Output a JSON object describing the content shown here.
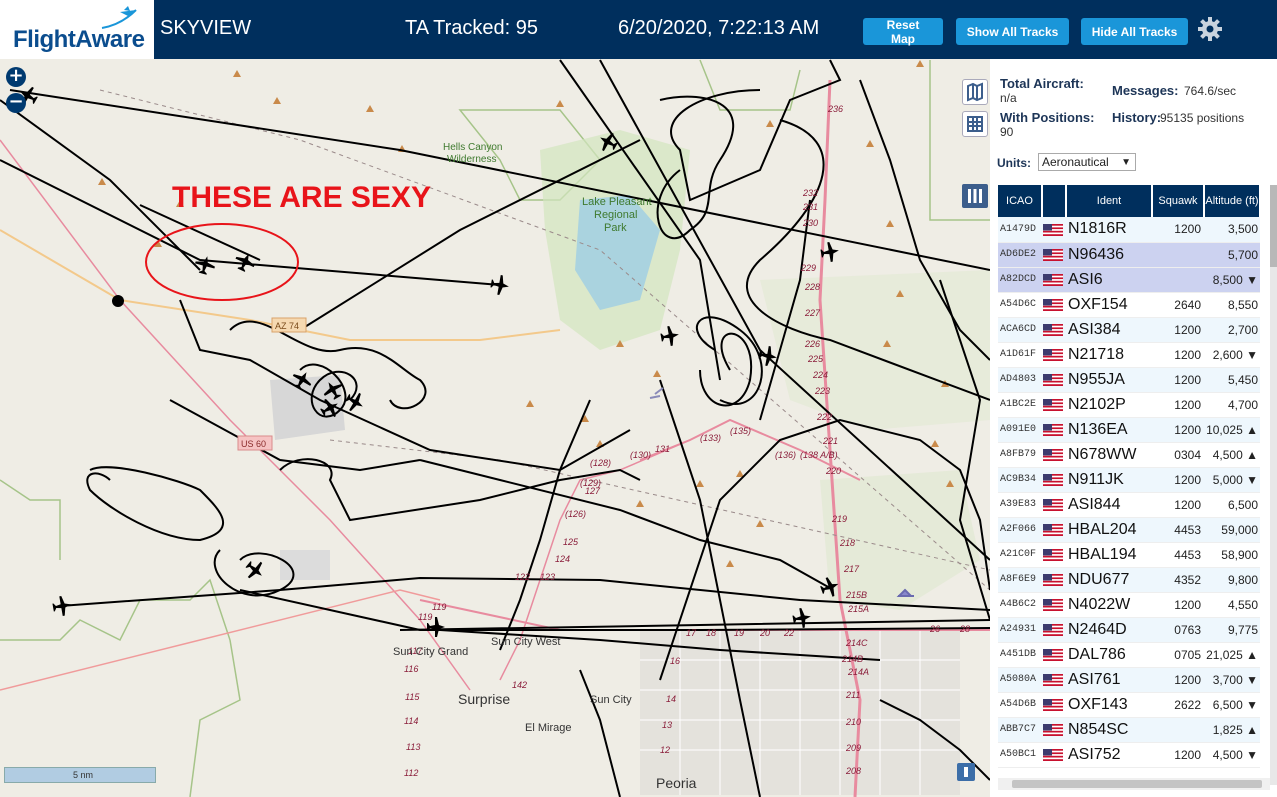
{
  "brand": {
    "logo_text": "FlightAware"
  },
  "header": {
    "title": "SKYVIEW",
    "ta_tracked": "TA Tracked: 95",
    "datetime": "6/20/2020, 7:22:13 AM",
    "buttons": {
      "reset": "Reset Map",
      "show_all": "Show All Tracks",
      "hide_all": "Hide All Tracks"
    }
  },
  "map": {
    "annotation": "THESE ARE SEXY",
    "labels": {
      "hells_canyon": "Hells Canyon",
      "wilderness": "Wilderness",
      "lake_pleasant_1": "Lake Pleasant",
      "lake_pleasant_2": "Regional",
      "lake_pleasant_3": "Park",
      "az74": "AZ 74",
      "us60": "US 60",
      "sun_city_grand": "Sun City Grand",
      "sun_city_west": "Sun City West",
      "surprise": "Surprise",
      "sun_city": "Sun City",
      "el_mirage": "El Mirage",
      "peoria": "Peoria"
    },
    "scale": "5 nm",
    "zoom_in": "+",
    "zoom_out": "−"
  },
  "panel": {
    "total_aircraft_label": "Total Aircraft:",
    "total_aircraft_value": "n/a",
    "messages_label": "Messages:",
    "messages_value": "764.6/sec",
    "with_positions_label": "With Positions:",
    "with_positions_value": "90",
    "history_label": "History:",
    "history_value": "95135 positions",
    "units_label": "Units:",
    "units_value": "Aeronautical",
    "columns": {
      "icao": "ICAO",
      "ident": "Ident",
      "squawk": "Squawk",
      "altitude": "Altitude (ft)"
    }
  },
  "aircraft": [
    {
      "icao": "A1479D",
      "ident": "N1816R",
      "squawk": "1200",
      "alt": "3,500",
      "trend": ""
    },
    {
      "icao": "AD6DE2",
      "ident": "N96436",
      "squawk": "",
      "alt": "5,700",
      "trend": ""
    },
    {
      "icao": "A82DCD",
      "ident": "ASI6",
      "squawk": "",
      "alt": "8,500",
      "trend": "▼"
    },
    {
      "icao": "A54D6C",
      "ident": "OXF154",
      "squawk": "2640",
      "alt": "8,550",
      "trend": ""
    },
    {
      "icao": "ACA6CD",
      "ident": "ASI384",
      "squawk": "1200",
      "alt": "2,700",
      "trend": ""
    },
    {
      "icao": "A1D61F",
      "ident": "N21718",
      "squawk": "1200",
      "alt": "2,600",
      "trend": "▼"
    },
    {
      "icao": "AD4803",
      "ident": "N955JA",
      "squawk": "1200",
      "alt": "5,450",
      "trend": ""
    },
    {
      "icao": "A1BC2E",
      "ident": "N2102P",
      "squawk": "1200",
      "alt": "4,700",
      "trend": ""
    },
    {
      "icao": "A091E0",
      "ident": "N136EA",
      "squawk": "1200",
      "alt": "10,025",
      "trend": "▲"
    },
    {
      "icao": "A8FB79",
      "ident": "N678WW",
      "squawk": "0304",
      "alt": "4,500",
      "trend": "▲"
    },
    {
      "icao": "AC9B34",
      "ident": "N911JK",
      "squawk": "1200",
      "alt": "5,000",
      "trend": "▼"
    },
    {
      "icao": "A39E83",
      "ident": "ASI844",
      "squawk": "1200",
      "alt": "6,500",
      "trend": ""
    },
    {
      "icao": "A2F066",
      "ident": "HBAL204",
      "squawk": "4453",
      "alt": "59,000",
      "trend": ""
    },
    {
      "icao": "A21C0F",
      "ident": "HBAL194",
      "squawk": "4453",
      "alt": "58,900",
      "trend": ""
    },
    {
      "icao": "A8F6E9",
      "ident": "NDU677",
      "squawk": "4352",
      "alt": "9,800",
      "trend": ""
    },
    {
      "icao": "A4B6C2",
      "ident": "N4022W",
      "squawk": "1200",
      "alt": "4,550",
      "trend": ""
    },
    {
      "icao": "A24931",
      "ident": "N2464D",
      "squawk": "0763",
      "alt": "9,775",
      "trend": ""
    },
    {
      "icao": "A451DB",
      "ident": "DAL786",
      "squawk": "0705",
      "alt": "21,025",
      "trend": "▲"
    },
    {
      "icao": "A5080A",
      "ident": "ASI761",
      "squawk": "1200",
      "alt": "3,700",
      "trend": "▼"
    },
    {
      "icao": "A54D6B",
      "ident": "OXF143",
      "squawk": "2622",
      "alt": "6,500",
      "trend": "▼"
    },
    {
      "icao": "ABB7C7",
      "ident": "N854SC",
      "squawk": "",
      "alt": "1,825",
      "trend": "▲"
    },
    {
      "icao": "A50BC1",
      "ident": "ASI752",
      "squawk": "1200",
      "alt": "4,500",
      "trend": "▼"
    }
  ],
  "colors": {
    "header_bg": "#002f5d",
    "button_bg": "#1a96d9",
    "map_bg": "#efede5",
    "park_green": "#d3e6bf",
    "water": "#aad3df",
    "track": "#000000",
    "annotation_red": "#e8141a",
    "highway": "#e88b9f",
    "road_orange": "#f3c98b"
  },
  "icons": [
    "gear-icon",
    "plane-icon",
    "layers-icon",
    "grid-icon",
    "columns-icon",
    "us-flag-icon",
    "fullscreen-icon"
  ]
}
